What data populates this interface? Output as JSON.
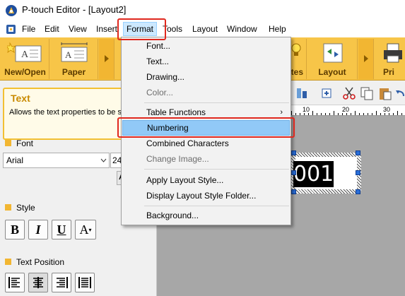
{
  "window": {
    "title": "P-touch Editor - [Layout2]"
  },
  "menubar": {
    "items": [
      {
        "label": "File"
      },
      {
        "label": "Edit"
      },
      {
        "label": "View"
      },
      {
        "label": "Insert"
      },
      {
        "label": "Format"
      },
      {
        "label": "Tools"
      },
      {
        "label": "Layout"
      },
      {
        "label": "Window"
      },
      {
        "label": "Help"
      }
    ]
  },
  "ribbon": {
    "new_open": "New/Open",
    "paper": "Paper",
    "notes": "otes",
    "layout": "Layout",
    "print": "Pri"
  },
  "sidepanel": {
    "title": "Text",
    "description": "Allows the text properties to be specified.",
    "font_section": "Font",
    "font_name": "Arial",
    "font_size": "24",
    "small_button": "A",
    "style_section": "Style",
    "style_buttons": [
      "B",
      "I",
      "U",
      "A"
    ],
    "position_section": "Text Position"
  },
  "ruler": {
    "marks": [
      "10",
      "20",
      "30"
    ]
  },
  "canvas": {
    "label_text": "001"
  },
  "format_menu": {
    "items": [
      {
        "label": "Font..."
      },
      {
        "label": "Text..."
      },
      {
        "label": "Drawing..."
      },
      {
        "label": "Color..."
      },
      {
        "label": "Table Functions"
      },
      {
        "label": "Numbering"
      },
      {
        "label": "Combined Characters"
      },
      {
        "label": "Change Image..."
      },
      {
        "label": "Apply Layout Style..."
      },
      {
        "label": "Display Layout Style Folder..."
      },
      {
        "label": "Background..."
      }
    ]
  },
  "colors": {
    "ribbon": "#f7c548",
    "highlight": "#91c9f7",
    "annotation": "#e0281e"
  }
}
